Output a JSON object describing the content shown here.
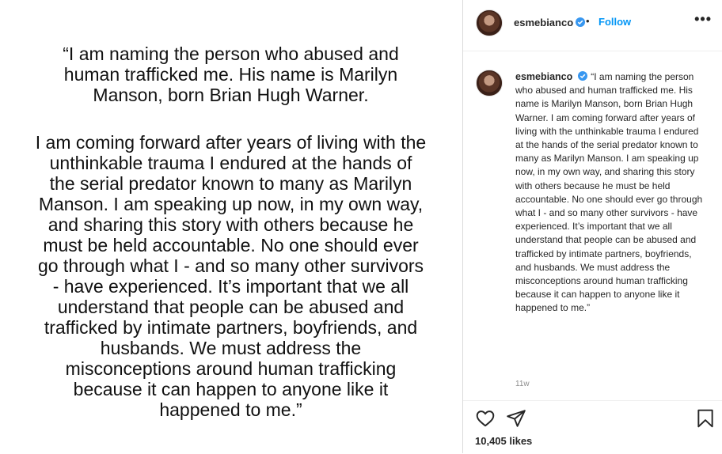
{
  "post_image": {
    "quote_paragraph_1": [
      "“I am naming the person who abused and",
      "human trafficked me. His name is Marilyn",
      "Manson, born Brian Hugh Warner."
    ],
    "quote_paragraph_2": [
      "I am coming forward after years of living with the",
      "unthinkable trauma I endured at the hands of",
      "the serial predator known to many as Marilyn",
      "Manson. I am speaking up now, in my own way,",
      "and sharing this story with others because he",
      "must be held accountable. No one should ever",
      "go through what I - and so many other survivors",
      "- have experienced. It’s important that we all",
      "understand that people can be abused and",
      "trafficked by intimate partners, boyfriends, and",
      "husbands. We must address the",
      "misconceptions around human trafficking",
      "because it can happen to anyone like it",
      "happened to me.”"
    ]
  },
  "header": {
    "username": "esmebianco",
    "separator": "•",
    "follow_label": "Follow",
    "more_label": "•••"
  },
  "caption": {
    "username": "esmebianco",
    "text": "“I am naming the person who abused and human trafficked me. His name is Marilyn Manson, born Brian Hugh Warner. I am coming forward after years of living with the unthinkable trauma I endured at the hands of the serial predator known to many as Marilyn Manson. I am speaking up now, in my own way, and sharing this story with others because he must be held accountable. No one should ever go through what I - and so many other survivors - have experienced. It’s important that we all understand that people can be abused and trafficked by intimate partners, boyfriends, and husbands. We must address the misconceptions around human trafficking because it can happen to anyone like it happened to me.”",
    "timestamp": "11w"
  },
  "actions": {
    "likes": "10,405 likes",
    "icons": [
      "heart-icon",
      "share-icon",
      "bookmark-icon"
    ]
  },
  "colors": {
    "link_blue": "#0095f6",
    "verified_blue": "#3897f0",
    "muted_gray": "#8e8e8e",
    "text": "#262626",
    "border": "#dbdbdb"
  }
}
